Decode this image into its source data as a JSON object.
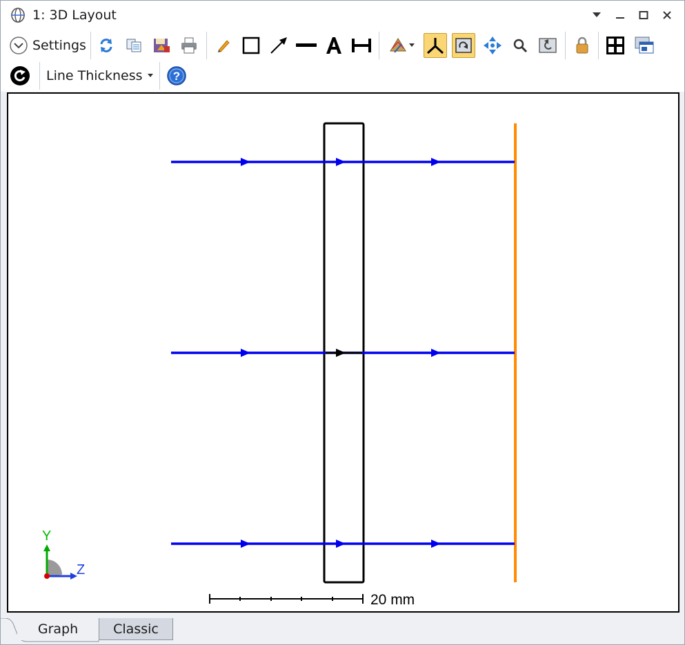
{
  "window": {
    "title": "1: 3D Layout"
  },
  "toolbar": {
    "settings_label": "Settings",
    "line_thickness_label": "Line Thickness",
    "icons": [
      "refresh-icon",
      "copy-icon",
      "save-icon",
      "print-icon",
      "pencil-icon",
      "rectangle-icon",
      "arrow-icon",
      "line-icon",
      "text-icon",
      "dimension-icon",
      "rotate-view-icon",
      "axes-icon",
      "3d-rotate-icon",
      "pan-icon",
      "zoom-icon",
      "reset-zoom-icon",
      "lock-icon",
      "fit-icon",
      "window-icon",
      "auto-update-icon",
      "help-icon"
    ]
  },
  "plot": {
    "scale_bar_label": "20 mm",
    "axis_y_label": "Y",
    "axis_z_label": "Z",
    "ray_color": "#0000ee",
    "image_plane_color": "#ff8c00",
    "lens_color": "#000000"
  },
  "tabs": {
    "graph": "Graph",
    "classic": "Classic"
  }
}
